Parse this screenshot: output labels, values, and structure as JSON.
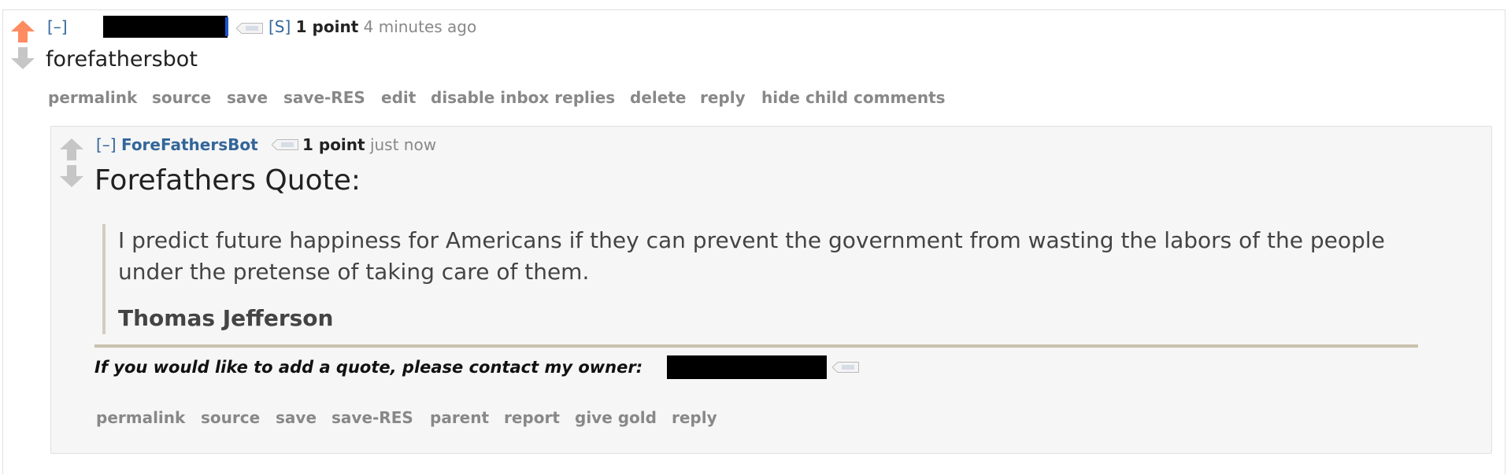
{
  "parent_comment": {
    "collapse_label": "[–]",
    "submitter_tag": "[S]",
    "score": "1 point",
    "time": "4 minutes ago",
    "body": "forefathersbot",
    "buttons": [
      "permalink",
      "source",
      "save",
      "save-RES",
      "edit",
      "disable inbox replies",
      "delete",
      "reply",
      "hide child comments"
    ]
  },
  "child_comment": {
    "collapse_label": "[–]",
    "author": "ForeFathersBot",
    "score": "1 point",
    "time": "just now",
    "heading": "Forefathers Quote:",
    "quote_line_1": "I predict future happiness for Americans if they can prevent the government from wasting the labors of the people",
    "quote_line_2": "under the pretense of taking care of them.",
    "quote_author": "Thomas Jefferson",
    "footer_note": "If you would like to add a quote, please contact my owner:",
    "buttons": [
      "permalink",
      "source",
      "save",
      "save-RES",
      "parent",
      "report",
      "give gold",
      "reply"
    ]
  },
  "colors": {
    "upvote_active": "#ff8b60",
    "vote_inactive": "#c6c6c6",
    "link_blue": "#336699",
    "muted_gray": "#888888",
    "child_background": "#f6f6f6",
    "quote_bar": "#d2cdbf",
    "redaction": "#000000"
  },
  "icons": {
    "upvote": "upvote-arrow-icon",
    "downvote": "downvote-arrow-icon",
    "user_tag": "user-tag-icon"
  }
}
